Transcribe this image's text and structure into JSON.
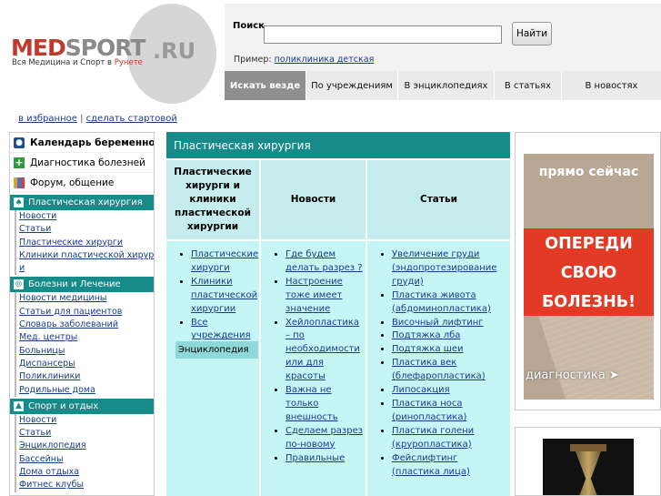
{
  "logo": {
    "med": "MED",
    "sport": "SPORT",
    "ru": ".RU",
    "tagline_pre": "Вся Медицина и Спорт в ",
    "tagline_red": "Рунете"
  },
  "search": {
    "label": "Поиск",
    "value": "",
    "button": "Найти",
    "example_label": "Пример:",
    "example_link": "поликлиника детская"
  },
  "tabs": [
    "Искать везде",
    "По учреждениям",
    "В энциклопедиях",
    "В статьях",
    "В новостях"
  ],
  "fav_links": {
    "bookmark": "в избранное",
    "separator": "|",
    "homepage": "сделать стартовой"
  },
  "sidebar": {
    "top_items": [
      {
        "label": "Календарь беременности",
        "icon": "calendar-icon",
        "bold": true
      },
      {
        "label": "Диагностика болезней",
        "icon": "plus-cross-icon",
        "bold": false
      },
      {
        "label": "Форум, общение",
        "icon": "people-icon",
        "bold": false
      }
    ],
    "sections": [
      {
        "title": "Пластическая хирургия",
        "icon": "figure-icon",
        "items": [
          "Новости",
          "Статьи",
          "Пластические хирурги",
          "Клиники пластической хирурги",
          "и"
        ]
      },
      {
        "title": "Болезни и Лечение",
        "icon": "pill-icon",
        "items": [
          "Новости медицины",
          "Статьи для пациентов",
          "Словарь заболеваний",
          "Мед. центры",
          "Больницы",
          "Диспансеры",
          "Поликлиники",
          "Родильные дома"
        ]
      },
      {
        "title": "Спорт и отдых",
        "icon": "sport-icon",
        "items": [
          "Новости",
          "Статьи",
          "Энциклопедия",
          "Бассейны",
          "Дома отдыха",
          "Фитнес клубы"
        ]
      }
    ]
  },
  "center": {
    "title": "Пластическая хирургия",
    "headers": [
      "Пластические хирурги и клиники пластической хирургии",
      "Новости",
      "Статьи"
    ],
    "col1_items": [
      "Пластические хирурги",
      "Клиники пластической хирургии",
      "Все учреждения"
    ],
    "encyclopedia_label": "Энциклопедия",
    "col2_items": [
      "Где будем делать разрез ?",
      "Настроение тоже имеет значение",
      "Хейлопластика – по необходимости или для красоты",
      "Важна не только внешность",
      "Сделаем разрез по-новому",
      "Правильные"
    ],
    "col3_items": [
      "Увеличение груди (эндопротезирование груди)",
      "Пластика живота (абдоминопластика)",
      "Височный лифтинг",
      "Подтяжка лба",
      "Подтяжка шеи",
      "Пластика век (блефаропластика)",
      "Липосакция",
      "Пластика носа (ринопластика)",
      "Пластика голени (круропластика)",
      "Фейслифтинг (пластика лица)"
    ]
  },
  "ad": {
    "now": "прямо сейчас",
    "line1": "ОПЕРЕДИ",
    "line2": "СВОЮ",
    "line3": "БОЛЕЗНЬ!",
    "diag": "диагностика"
  }
}
